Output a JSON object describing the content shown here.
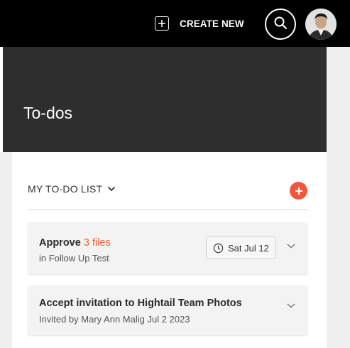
{
  "header": {
    "create_label": "CREATE NEW",
    "plus_icon": "plus-icon",
    "search_icon": "search-icon",
    "avatar": "user-avatar"
  },
  "page": {
    "title": "To-dos"
  },
  "todo_list": {
    "title": "MY TO-DO LIST",
    "dropdown_icon": "chevron-down-icon",
    "add_icon": "plus-icon",
    "accent_color": "#f0573b",
    "items": [
      {
        "title_prefix": "Approve",
        "title_highlight": "3 files",
        "subtitle": "in Follow Up Test",
        "due_date": "Sat Jul 12",
        "due_icon": "clock-icon",
        "expand_icon": "chevron-down-icon"
      },
      {
        "title": "Accept invitation to Hightail Team Photos",
        "subtitle": "Invited by Mary Ann Malig Jul 2 2023",
        "expand_icon": "chevron-down-icon"
      }
    ]
  }
}
